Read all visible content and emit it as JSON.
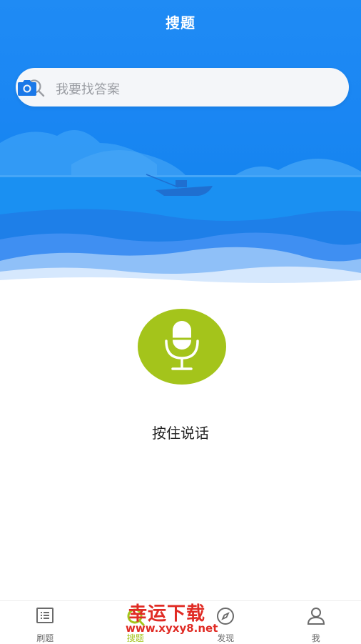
{
  "header": {
    "title": "搜题"
  },
  "search": {
    "placeholder": "我要找答案"
  },
  "voice": {
    "label": "按住说话"
  },
  "colors": {
    "brand_blue": "#1a86f3",
    "accent_green": "#a4c41b",
    "search_bg": "#f4f6f9"
  },
  "tabbar": {
    "items": [
      {
        "label": "刷题",
        "icon": "list-icon"
      },
      {
        "label": "搜题",
        "icon": "search-tab-icon"
      },
      {
        "label": "发现",
        "icon": "compass-icon"
      },
      {
        "label": "我",
        "icon": "person-icon"
      }
    ],
    "active_index": 1
  },
  "watermark": {
    "text": "幸运下载",
    "url": "www.xyxy8.net"
  }
}
